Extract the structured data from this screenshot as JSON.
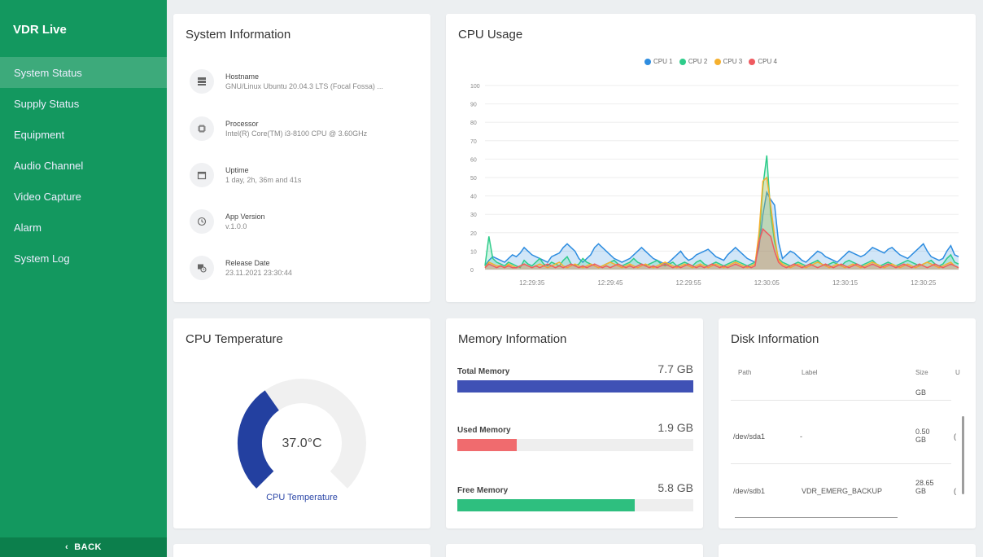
{
  "app": {
    "title": "VDR Live",
    "back_label": "BACK"
  },
  "sidebar": {
    "items": [
      {
        "label": "System Status",
        "active": true
      },
      {
        "label": "Supply Status",
        "active": false
      },
      {
        "label": "Equipment",
        "active": false
      },
      {
        "label": "Audio Channel",
        "active": false
      },
      {
        "label": "Video Capture",
        "active": false
      },
      {
        "label": "Alarm",
        "active": false
      },
      {
        "label": "System Log",
        "active": false
      }
    ]
  },
  "system_info": {
    "title": "System Information",
    "rows": [
      {
        "icon": "server-icon",
        "label": "Hostname",
        "value": "GNU/Linux Ubuntu 20.04.3 LTS (Focal Fossa) ..."
      },
      {
        "icon": "chip-icon",
        "label": "Processor",
        "value": "Intel(R) Core(TM) i3-8100 CPU @ 3.60GHz"
      },
      {
        "icon": "calendar-icon",
        "label": "Uptime",
        "value": "1 day, 2h, 36m and 41s"
      },
      {
        "icon": "history-icon",
        "label": "App Version",
        "value": "v.1.0.0"
      },
      {
        "icon": "release-date-icon",
        "label": "Release Date",
        "value": "23.11.2021 23:30:44"
      }
    ]
  },
  "cpu_usage": {
    "title": "CPU Usage"
  },
  "chart_data": {
    "type": "area",
    "x": [
      "12:29:35",
      "12:29:45",
      "12:29:55",
      "12:30:05",
      "12:30:15",
      "12:30:25"
    ],
    "ylim": [
      0,
      100
    ],
    "yticks": [
      0,
      10,
      20,
      30,
      40,
      50,
      60,
      70,
      80,
      90,
      100
    ],
    "grid": true,
    "legend": "top-center",
    "series": [
      {
        "name": "CPU 1",
        "color": "#2e8de0",
        "values": [
          2,
          5,
          7,
          6,
          5,
          4,
          6,
          8,
          7,
          9,
          12,
          10,
          8,
          7,
          6,
          5,
          4,
          7,
          8,
          9,
          12,
          14,
          12,
          10,
          6,
          4,
          6,
          8,
          12,
          14,
          12,
          10,
          8,
          6,
          5,
          4,
          5,
          6,
          8,
          10,
          12,
          10,
          8,
          6,
          5,
          4,
          3,
          4,
          6,
          8,
          10,
          7,
          5,
          6,
          8,
          9,
          10,
          11,
          9,
          7,
          6,
          5,
          8,
          10,
          12,
          10,
          8,
          6,
          5,
          4,
          12,
          30,
          42,
          38,
          35,
          15,
          6,
          8,
          10,
          9,
          7,
          5,
          4,
          6,
          8,
          10,
          9,
          7,
          6,
          5,
          4,
          6,
          8,
          10,
          9,
          8,
          7,
          8,
          10,
          12,
          11,
          10,
          9,
          11,
          12,
          10,
          8,
          7,
          6,
          8,
          10,
          12,
          14,
          10,
          7,
          6,
          5,
          6,
          10,
          13,
          8,
          7
        ]
      },
      {
        "name": "CPU 2",
        "color": "#2ecc8a",
        "values": [
          2,
          18,
          6,
          4,
          3,
          2,
          4,
          3,
          2,
          1,
          5,
          3,
          2,
          4,
          6,
          3,
          2,
          4,
          3,
          2,
          5,
          7,
          3,
          2,
          3,
          6,
          4,
          3,
          2,
          1,
          2,
          3,
          4,
          5,
          3,
          2,
          3,
          4,
          6,
          4,
          3,
          2,
          3,
          4,
          5,
          3,
          2,
          3,
          4,
          2,
          3,
          4,
          3,
          2,
          4,
          5,
          3,
          2,
          3,
          4,
          3,
          2,
          3,
          4,
          5,
          4,
          3,
          2,
          3,
          4,
          15,
          45,
          62,
          30,
          15,
          6,
          4,
          3,
          2,
          3,
          4,
          3,
          2,
          3,
          4,
          5,
          3,
          2,
          3,
          4,
          3,
          2,
          4,
          5,
          4,
          3,
          2,
          3,
          4,
          5,
          3,
          2,
          3,
          4,
          3,
          2,
          3,
          4,
          5,
          4,
          3,
          2,
          3,
          4,
          5,
          3,
          2,
          3,
          6,
          8,
          4,
          3
        ]
      },
      {
        "name": "CPU 3",
        "color": "#f5b02e",
        "values": [
          1,
          4,
          3,
          2,
          2,
          1,
          3,
          2,
          1,
          2,
          3,
          2,
          1,
          2,
          3,
          2,
          1,
          2,
          3,
          4,
          2,
          1,
          2,
          3,
          2,
          1,
          2,
          3,
          2,
          1,
          2,
          3,
          4,
          3,
          2,
          1,
          2,
          3,
          2,
          1,
          2,
          3,
          2,
          1,
          2,
          3,
          4,
          3,
          2,
          1,
          2,
          3,
          2,
          1,
          2,
          3,
          2,
          1,
          2,
          3,
          2,
          1,
          2,
          3,
          4,
          3,
          2,
          1,
          2,
          3,
          20,
          48,
          50,
          35,
          18,
          5,
          3,
          2,
          1,
          2,
          3,
          2,
          1,
          2,
          3,
          4,
          3,
          2,
          1,
          2,
          3,
          2,
          1,
          2,
          3,
          2,
          1,
          2,
          3,
          4,
          3,
          2,
          1,
          2,
          3,
          2,
          1,
          2,
          3,
          2,
          1,
          2,
          3,
          4,
          3,
          2,
          1,
          2,
          3,
          4,
          2,
          1
        ]
      },
      {
        "name": "CPU 4",
        "color": "#ef5a60",
        "values": [
          1,
          3,
          2,
          1,
          2,
          1,
          2,
          1,
          1,
          2,
          3,
          2,
          1,
          2,
          1,
          2,
          3,
          2,
          1,
          2,
          1,
          2,
          3,
          2,
          1,
          2,
          1,
          2,
          3,
          2,
          1,
          2,
          1,
          2,
          3,
          2,
          1,
          2,
          1,
          2,
          3,
          2,
          1,
          2,
          1,
          2,
          3,
          2,
          1,
          2,
          1,
          2,
          3,
          2,
          1,
          2,
          1,
          2,
          3,
          2,
          1,
          2,
          1,
          2,
          3,
          2,
          1,
          2,
          1,
          2,
          15,
          22,
          20,
          18,
          10,
          4,
          2,
          1,
          2,
          3,
          2,
          1,
          2,
          3,
          2,
          1,
          2,
          3,
          2,
          1,
          2,
          3,
          2,
          1,
          2,
          3,
          2,
          1,
          2,
          3,
          2,
          1,
          2,
          3,
          2,
          1,
          2,
          3,
          2,
          1,
          2,
          3,
          2,
          1,
          2,
          3,
          2,
          1,
          2,
          3,
          2,
          1
        ]
      }
    ]
  },
  "cpu_temperature": {
    "title": "CPU Temperature",
    "value": "37.0°C",
    "gauge_label": "CPU Temperature",
    "fraction": 0.37,
    "color": "#2340a0"
  },
  "memory": {
    "title": "Memory Information",
    "rows": [
      {
        "label": "Total Memory",
        "value": "7.7 GB",
        "fraction": 1.0,
        "color": "#3f51b5"
      },
      {
        "label": "Used Memory",
        "value": "1.9 GB",
        "fraction": 0.25,
        "color": "#f06b6e"
      },
      {
        "label": "Free Memory",
        "value": "5.8 GB",
        "fraction": 0.75,
        "color": "#2ebf7f"
      }
    ]
  },
  "disk": {
    "title": "Disk Information",
    "headers": {
      "path": "Path",
      "label": "Label",
      "size": "Size",
      "extra": "U"
    },
    "partial_row": {
      "size": "GB"
    },
    "rows": [
      {
        "path": "/dev/sda1",
        "label": "-",
        "size": "0.50 GB",
        "extra": "("
      },
      {
        "path": "/dev/sdb1",
        "label": "VDR_EMERG_BACKUP",
        "size": "28.65 GB",
        "extra": "("
      }
    ]
  }
}
